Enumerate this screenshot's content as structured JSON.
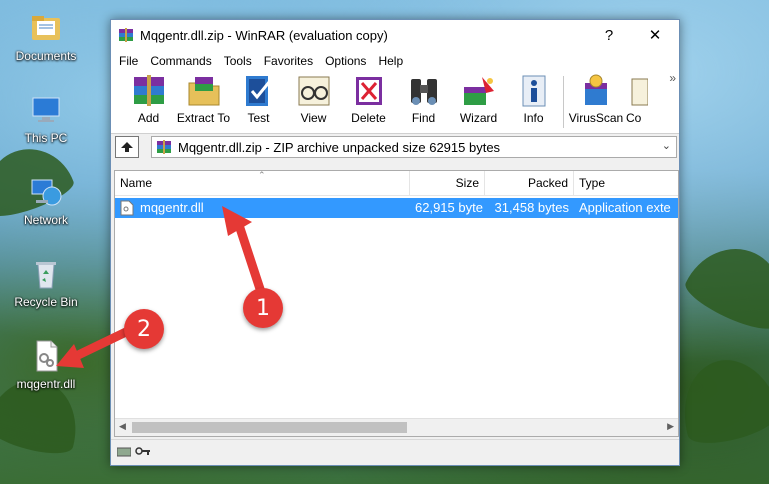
{
  "desktop": {
    "icons": [
      {
        "label": "Documents",
        "icon": "folder-documents-icon"
      },
      {
        "label": "This PC",
        "icon": "computer-icon"
      },
      {
        "label": "Network",
        "icon": "network-icon"
      },
      {
        "label": "Recycle Bin",
        "icon": "recycle-bin-icon"
      },
      {
        "label": "mqgentr.dll",
        "icon": "dll-file-icon"
      }
    ]
  },
  "window": {
    "title": "Mqgentr.dll.zip - WinRAR (evaluation copy)",
    "help_btn": "?",
    "close_btn": "✕",
    "menu": [
      "File",
      "Commands",
      "Tools",
      "Favorites",
      "Options",
      "Help"
    ],
    "toolbar": [
      "Add",
      "Extract To",
      "Test",
      "View",
      "Delete",
      "Find",
      "Wizard",
      "Info",
      "VirusScan",
      "Co"
    ],
    "toolbar_overflow": "»",
    "address": "Mqgentr.dll.zip - ZIP archive unpacked size 62915 bytes",
    "columns": [
      "Name",
      "Size",
      "Packed",
      "Type"
    ],
    "files": [
      {
        "name": "mqgentr.dll",
        "size": "62,915 byte",
        "packed": "31,458 bytes",
        "type": "Application exte"
      }
    ]
  },
  "annotations": {
    "one": "1",
    "two": "2"
  },
  "colors": {
    "selection": "#3399ff",
    "badge": "#e53935"
  }
}
